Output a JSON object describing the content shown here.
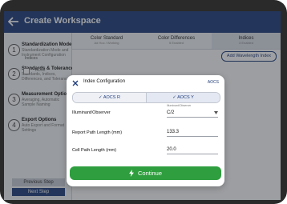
{
  "header": {
    "title": "Create Workspace"
  },
  "sidebar": {
    "steps": [
      {
        "num": "1",
        "title": "Standardization Mode",
        "desc": [
          "Standardization Mode and",
          "Instrument Configuration"
        ]
      },
      {
        "num": "2",
        "title": "Standards & Tolerances",
        "desc": [
          "Standards, Indices,",
          "Differences, and Tolerances"
        ]
      },
      {
        "num": "3",
        "title": "Measurement Options",
        "desc": [
          "Averaging, Automatic",
          "Sample Naming"
        ]
      },
      {
        "num": "4",
        "title": "Export Options",
        "desc": [
          "Auto Export and Format",
          "Settings"
        ]
      }
    ],
    "prev_label": "Previous Step",
    "next_label": "Next Step"
  },
  "tabs": [
    {
      "label": "Color Standard",
      "sub": "Ad Hoc / Working"
    },
    {
      "label": "Color Differences",
      "sub": "5 Enabled"
    },
    {
      "label": "Indices",
      "sub": "3 Enabled"
    }
  ],
  "content": {
    "indices_label": "Indices",
    "add_wavelength_label": "Add Wavelength Index",
    "row_label": "ADMI"
  },
  "dialog": {
    "title": "Index Configuration",
    "subtitle": "AOCS",
    "segments": [
      "✓ AOCS R",
      "✓ AOCS Y"
    ],
    "illuminant_label": "Illuminant/Observer",
    "illuminant_caption": "Illuminant/Observer",
    "illuminant_value": "C/2",
    "report_path_label": "Report Path Length (mm)",
    "report_path_value": "133.3",
    "cell_path_label": "Cell Path Length (mm)",
    "cell_path_value": "20.0",
    "continue_label": "Continue"
  },
  "colors": {
    "header": "#1f3c7a",
    "accent": "#1f3c7a",
    "continue": "#2e9e3e"
  },
  "icons": [
    "back-arrow-icon",
    "close-icon",
    "chevron-down-icon",
    "lightning-bolt-icon"
  ]
}
